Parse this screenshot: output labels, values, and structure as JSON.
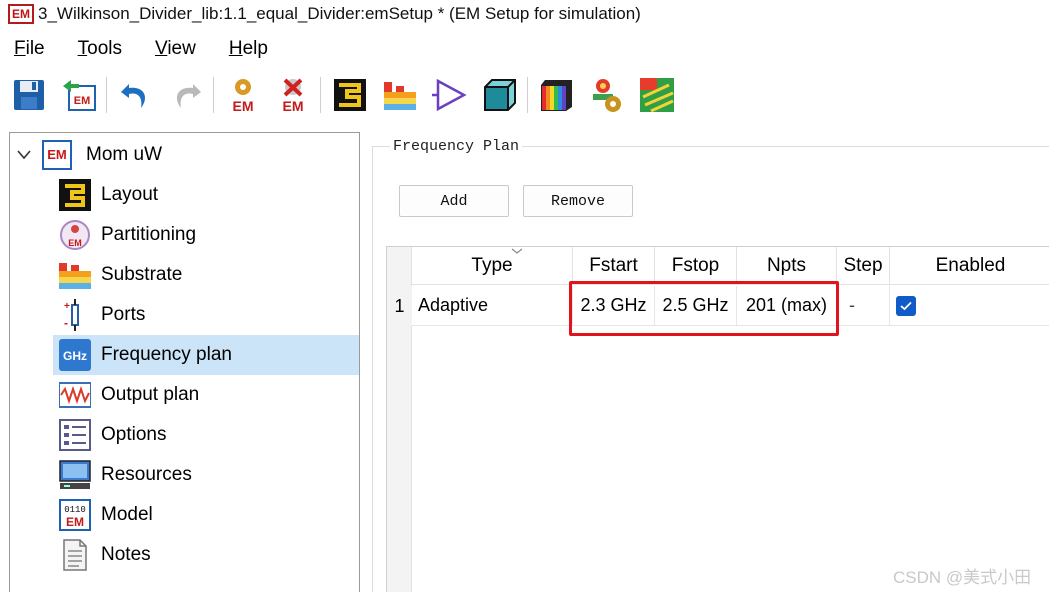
{
  "window": {
    "title": "3_Wilkinson_Divider_lib:1.1_equal_Divider:emSetup * (EM Setup for simulation)",
    "logo_text": "EM"
  },
  "menu": [
    {
      "label": "File",
      "ul": "F",
      "rest": "ile"
    },
    {
      "label": "Tools",
      "ul": "T",
      "rest": "ools"
    },
    {
      "label": "View",
      "ul": "V",
      "rest": "iew"
    },
    {
      "label": "Help",
      "ul": "H",
      "rest": "elp"
    }
  ],
  "toolbar": {
    "buttons": [
      "save-icon",
      "em-import-icon",
      "undo-icon",
      "redo-icon",
      "em-simulate-icon",
      "em-stop-icon",
      "layout-icon",
      "substrate-icon",
      "component-icon",
      "3d-view-icon",
      "color-bands-icon",
      "gear-tool-icon",
      "current-view-icon"
    ],
    "em_label": "EM"
  },
  "tree": {
    "root": {
      "label": "Mom uW",
      "badge": "EM"
    },
    "items": [
      {
        "label": "Layout",
        "icon": "layout-icon"
      },
      {
        "label": "Partitioning",
        "icon": "partitioning-icon"
      },
      {
        "label": "Substrate",
        "icon": "substrate-icon"
      },
      {
        "label": "Ports",
        "icon": "ports-icon"
      },
      {
        "label": "Frequency plan",
        "icon": "frequency-plan-icon",
        "selected": true,
        "icon_text": "GHz"
      },
      {
        "label": "Output plan",
        "icon": "output-plan-icon"
      },
      {
        "label": "Options",
        "icon": "options-icon"
      },
      {
        "label": "Resources",
        "icon": "resources-icon"
      },
      {
        "label": "Model",
        "icon": "model-icon",
        "icon_text_top": "0110",
        "icon_text_bottom": "EM"
      },
      {
        "label": "Notes",
        "icon": "notes-icon"
      }
    ]
  },
  "frequency_plan": {
    "group_title": "Frequency Plan",
    "add_label": "Add",
    "remove_label": "Remove",
    "columns": [
      "Type",
      "Fstart",
      "Fstop",
      "Npts",
      "Step",
      "Enabled"
    ],
    "rows": [
      {
        "num": "1",
        "type": "Adaptive",
        "fstart": "2.3 GHz",
        "fstop": "2.5 GHz",
        "npts": "201 (max)",
        "step": "-",
        "enabled": true
      }
    ]
  },
  "watermark": "CSDN @美式小田",
  "colors": {
    "selection": "#cce4f7",
    "highlight_box": "#e3131b",
    "checkbox": "#0f5cc8",
    "em_red": "#c41a1a"
  }
}
